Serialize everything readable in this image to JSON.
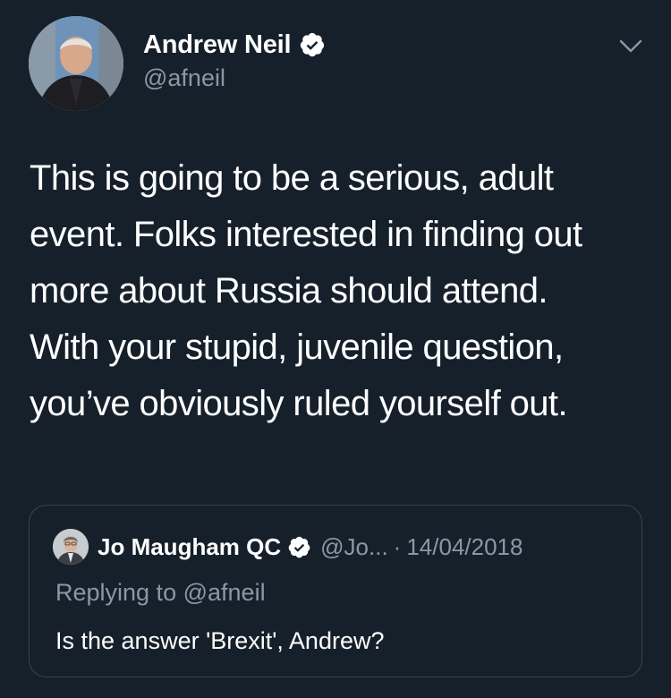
{
  "author": {
    "name": "Andrew Neil",
    "handle": "@afneil",
    "verified": true
  },
  "tweet": {
    "text": "This is going to be a serious, adult\nevent. Folks interested in finding out\nmore about Russia should attend.\nWith your stupid, juvenile question,\nyou’ve obviously ruled yourself out."
  },
  "quoted_tweet": {
    "author_name": "Jo Maugham QC",
    "author_handle": "@Jo...",
    "separator": "·",
    "date": "14/04/2018",
    "replying_prefix": "Replying to",
    "replying_handle": "@afneil",
    "text": "Is the answer 'Brexit', Andrew?",
    "verified": true
  },
  "colors": {
    "background": "#15202b",
    "text_primary": "#ffffff",
    "text_secondary": "#8899a6",
    "border": "#38444d",
    "verified_badge": "#ffffff"
  },
  "icons": {
    "verified": "verified-badge-icon",
    "menu": "chevron-down-icon"
  }
}
